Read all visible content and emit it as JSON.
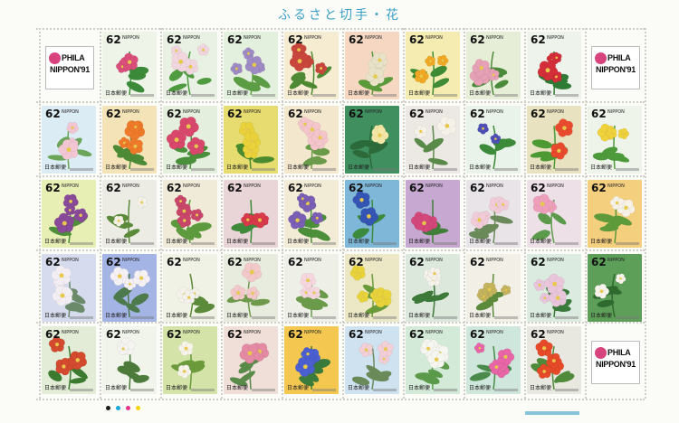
{
  "sheet_title": "ふるさと切手・花",
  "logo_text_line1": "PHILA",
  "logo_text_line2": "NIPPON'91",
  "stamp": {
    "denomination": "62",
    "brand": "NIPPON",
    "issuer": "日本郵便"
  },
  "flowers": [
    {
      "bg": "#eef4e8",
      "fl": "#d94e7a",
      "lf": "#3b8a3a"
    },
    {
      "bg": "#e8f1e4",
      "fl": "#f2d6df",
      "lf": "#4f9b3f"
    },
    {
      "bg": "#e3f0de",
      "fl": "#9e8ac4",
      "lf": "#5c9c44"
    },
    {
      "bg": "#f5ecd2",
      "fl": "#c9463c",
      "lf": "#4e8a33"
    },
    {
      "bg": "#f6d8c2",
      "fl": "#e8e2c8",
      "lf": "#5a9a3a"
    },
    {
      "bg": "#f4ecb0",
      "fl": "#f1a824",
      "lf": "#3e8a35"
    },
    {
      "bg": "#e7eed8",
      "fl": "#e6a1b6",
      "lf": "#4a8a3a"
    },
    {
      "bg": "#eef3ec",
      "fl": "#d42e3a",
      "lf": "#2f7a34"
    },
    {
      "bg": "#dcecf4",
      "fl": "#f3c6d4",
      "lf": "#6aa55a"
    },
    {
      "bg": "#f3e3b6",
      "fl": "#ee7a2a",
      "lf": "#4c8a36"
    },
    {
      "bg": "#e4efdd",
      "fl": "#d8486c",
      "lf": "#4a8f3a"
    },
    {
      "bg": "#e6dc70",
      "fl": "#e9d23a",
      "lf": "#4b8a2f"
    },
    {
      "bg": "#f3e8ce",
      "fl": "#f4c6cc",
      "lf": "#6a9a4a"
    },
    {
      "bg": "#3f8f5f",
      "fl": "#f4e6a4",
      "lf": "#2c6a3a"
    },
    {
      "bg": "#ece8e4",
      "fl": "#f6f2ea",
      "lf": "#5a8a4a"
    },
    {
      "bg": "#eaf3ea",
      "fl": "#4f4fb8",
      "lf": "#3c8a3a"
    },
    {
      "bg": "#e9e2c0",
      "fl": "#e94a2e",
      "lf": "#4d9a34"
    },
    {
      "bg": "#eef4ea",
      "fl": "#f0d23a",
      "lf": "#4c9a3a"
    },
    {
      "bg": "#e8efb4",
      "fl": "#8a4a9a",
      "lf": "#4f8f3a"
    },
    {
      "bg": "#ecece4",
      "fl": "#f4f2e6",
      "lf": "#5a8a3a"
    },
    {
      "bg": "#f0ead8",
      "fl": "#c9476a",
      "lf": "#5d9a3e"
    },
    {
      "bg": "#e9d4d8",
      "fl": "#d93a4a",
      "lf": "#3e8a3a"
    },
    {
      "bg": "#f2ecd6",
      "fl": "#7a5fb4",
      "lf": "#4c8f3a"
    },
    {
      "bg": "#7fb7d8",
      "fl": "#3555b4",
      "lf": "#3c8a3c"
    },
    {
      "bg": "#c6a8d0",
      "fl": "#d4477a",
      "lf": "#3f7f3a"
    },
    {
      "bg": "#e8e4e8",
      "fl": "#f1ccd8",
      "lf": "#6a8a5a"
    },
    {
      "bg": "#ede0e6",
      "fl": "#ee9fbc",
      "lf": "#5a9a4a"
    },
    {
      "bg": "#f4cf7e",
      "fl": "#f6f2e8",
      "lf": "#5f9a3a"
    },
    {
      "bg": "#d6dcee",
      "fl": "#f2eef4",
      "lf": "#6a8a6a"
    },
    {
      "bg": "#a4b4e4",
      "fl": "#f4f0f4",
      "lf": "#4c7a4c"
    },
    {
      "bg": "#eff2e4",
      "fl": "#f4f2ea",
      "lf": "#5a8a3a"
    },
    {
      "bg": "#e8ecde",
      "fl": "#f2c8c8",
      "lf": "#6f9a4c"
    },
    {
      "bg": "#eef0e8",
      "fl": "#f6d6df",
      "lf": "#6a9a4a"
    },
    {
      "bg": "#ece8c6",
      "fl": "#e8d43a",
      "lf": "#6a9a3a"
    },
    {
      "bg": "#dde8dc",
      "fl": "#f4f2ea",
      "lf": "#3d7a3a"
    },
    {
      "bg": "#f1efe6",
      "fl": "#c4b45e",
      "lf": "#5a8a3a"
    },
    {
      "bg": "#dcebe0",
      "fl": "#e9c6dc",
      "lf": "#3a7a3a"
    },
    {
      "bg": "#5d9f58",
      "fl": "#f6f4ec",
      "lf": "#2e6a2e"
    },
    {
      "bg": "#e2ecd6",
      "fl": "#d34a2e",
      "lf": "#3b7a2f"
    },
    {
      "bg": "#f0f4ea",
      "fl": "#f6f4f0",
      "lf": "#4c7a3a"
    },
    {
      "bg": "#d4e4a8",
      "fl": "#f6f4e8",
      "lf": "#6a9a3a"
    },
    {
      "bg": "#f0ded8",
      "fl": "#e48aa4",
      "lf": "#5a8a4a"
    },
    {
      "bg": "#f4c850",
      "fl": "#4a5fd0",
      "lf": "#3a7a3a"
    },
    {
      "bg": "#cfe2f0",
      "fl": "#f3cfd8",
      "lf": "#6a8a5a"
    },
    {
      "bg": "#d4ead8",
      "fl": "#f6f6f0",
      "lf": "#5a9a4a"
    },
    {
      "bg": "#cfe6dc",
      "fl": "#e866a8",
      "lf": "#4a8a4a"
    },
    {
      "bg": "#e8e8e0",
      "fl": "#e64a28",
      "lf": "#4f8a3a"
    }
  ],
  "color_dots": [
    "#1b1b1b",
    "#1aa7e0",
    "#e8338a",
    "#f6d400"
  ]
}
